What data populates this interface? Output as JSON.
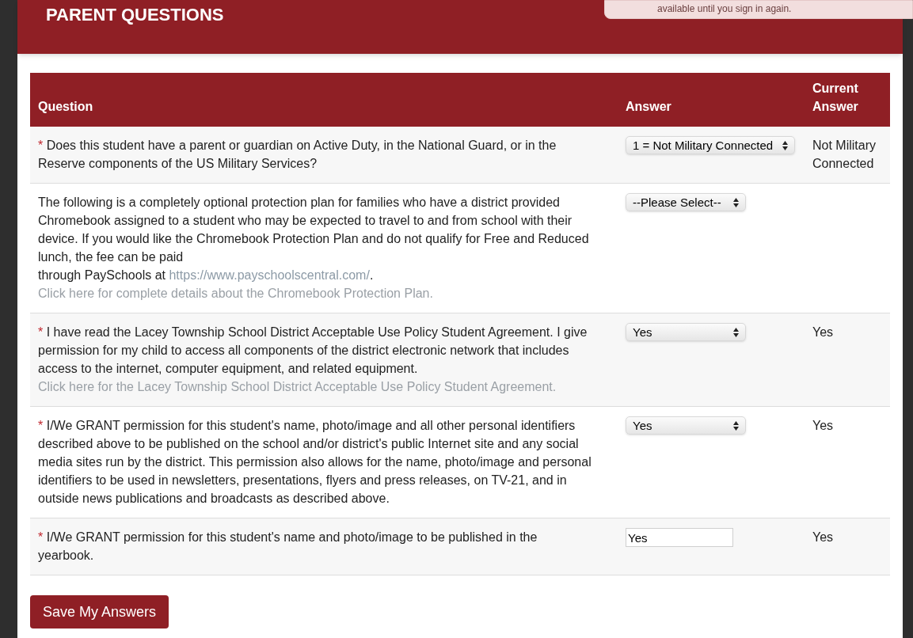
{
  "header": {
    "title": "PARENT QUESTIONS"
  },
  "notice": {
    "text": "available until you sign in again."
  },
  "table": {
    "columns": [
      "Question",
      "Answer",
      "Current Answer"
    ],
    "required_mark": "*",
    "rows": [
      {
        "required": true,
        "question": [
          {
            "kind": "text",
            "text": "Does this student have a parent or guardian on Active Duty, in the National Guard, or in the Reserve components of the US Military Services?"
          }
        ],
        "link": null,
        "answer": {
          "kind": "select",
          "value": "1 = Not Military Connected"
        },
        "current": "Not Military Connected"
      },
      {
        "required": false,
        "question": [
          {
            "kind": "text",
            "text": "The following is a completely optional protection plan for families who have a district provided Chromebook assigned to a student who may be expected to travel to and from school with their device.  If you would like the Chromebook Protection Plan and do not qualify for Free and Reduced lunch, the fee can be paid\nthrough PaySchools at "
          },
          {
            "kind": "link",
            "text": "https://www.payschoolscentral.com/"
          },
          {
            "kind": "text",
            "text": "."
          }
        ],
        "link": "Click here for complete details about the Chromebook Protection Plan.",
        "answer": {
          "kind": "select",
          "value": "--Please Select--"
        },
        "current": null
      },
      {
        "required": true,
        "question": [
          {
            "kind": "text",
            "text": "I have read the Lacey Township School District Acceptable Use Policy Student Agreement. I give permission for my child to access all components of the district electronic network that includes access to the internet, computer equipment, and related equipment."
          }
        ],
        "link": "Click here for the Lacey Township School District Acceptable Use Policy Student Agreement.",
        "answer": {
          "kind": "select",
          "value": "Yes"
        },
        "current": "Yes"
      },
      {
        "required": true,
        "question": [
          {
            "kind": "text",
            "text": "I/We GRANT permission for this student's name, photo/image and all other personal identifiers described above to be published on the school and/or district's public Internet site and any social media sites run by the district.  This permission also allows for the name, photo/image and personal identifiers to be used in newsletters, presentations, flyers and press releases, on TV-21, and in outside news publications and broadcasts as described above."
          }
        ],
        "link": null,
        "answer": {
          "kind": "select",
          "value": "Yes"
        },
        "current": "Yes"
      },
      {
        "required": true,
        "question": [
          {
            "kind": "text",
            "text": "I/We GRANT permission for this student's name and photo/image to be published in the yearbook."
          }
        ],
        "link": null,
        "answer": {
          "kind": "input",
          "value": "Yes"
        },
        "current": "Yes"
      }
    ]
  },
  "save_button": "Save My Answers"
}
